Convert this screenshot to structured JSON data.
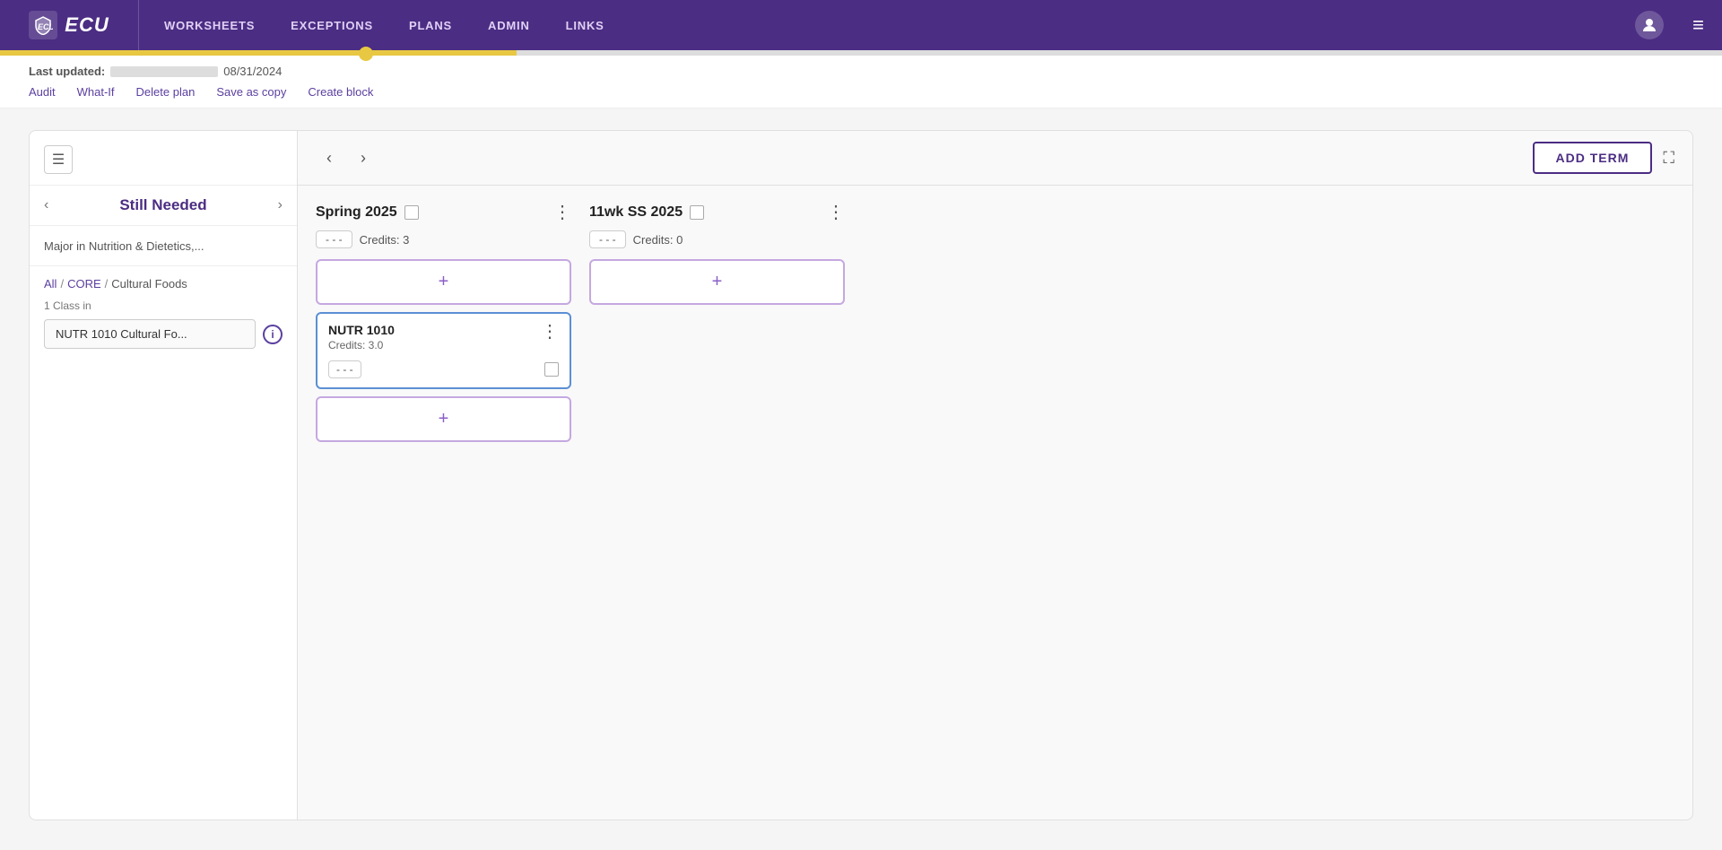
{
  "nav": {
    "logo_text": "ECU",
    "links": [
      "WORKSHEETS",
      "EXCEPTIONS",
      "PLANS",
      "ADMIN",
      "LINKS"
    ],
    "user_name": "",
    "hamburger": "≡"
  },
  "sub_toolbar": {
    "last_updated_label": "Last updated:",
    "last_updated_date": "08/31/2024",
    "actions": [
      "Audit",
      "What-If",
      "Delete plan",
      "Save as copy",
      "Create block"
    ]
  },
  "left_panel": {
    "hamburger_label": "☰",
    "still_needed_title": "Still Needed",
    "major_name": "Major in Nutrition & Dietetics,...",
    "breadcrumb": {
      "all": "All",
      "core": "CORE",
      "current": "Cultural Foods"
    },
    "class_count": "1 Class in",
    "class_item": "NUTR 1010  Cultural Fo..."
  },
  "right_panel": {
    "add_term_label": "ADD TERM",
    "terms": [
      {
        "id": "spring2025",
        "name": "Spring  2025",
        "credits_label": "Credits:",
        "credits_value": "3",
        "section_badge": "- - -",
        "courses": [
          {
            "code": "NUTR 1010",
            "credits": "Credits: 3.0",
            "section_badge": "- - -"
          }
        ]
      },
      {
        "id": "11wkss2025",
        "name": "11wk  SS  2025",
        "credits_label": "Credits:",
        "credits_value": "0",
        "section_badge": "- - -",
        "courses": []
      }
    ]
  }
}
